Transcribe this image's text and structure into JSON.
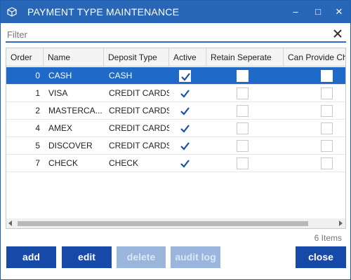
{
  "window": {
    "title": "PAYMENT TYPE MAINTENANCE",
    "minimize_glyph": "–",
    "maximize_glyph": "□",
    "close_glyph": "✕",
    "accent_color": "#2866b8"
  },
  "filter": {
    "placeholder": "Filter",
    "value": ""
  },
  "grid": {
    "columns": [
      "Order",
      "Name",
      "Deposit Type",
      "Active",
      "Retain Seperate",
      "Can Provide Cha"
    ],
    "selected_row": 0,
    "rows": [
      {
        "order": "0",
        "name": "CASH",
        "deposit_type": "CASH",
        "active": true,
        "retain_separate": false,
        "can_provide": false
      },
      {
        "order": "1",
        "name": "VISA",
        "deposit_type": "CREDIT CARDS",
        "active": true,
        "retain_separate": false,
        "can_provide": false
      },
      {
        "order": "2",
        "name": "MASTERCA...",
        "deposit_type": "CREDIT CARDS",
        "active": true,
        "retain_separate": false,
        "can_provide": false
      },
      {
        "order": "4",
        "name": "AMEX",
        "deposit_type": "CREDIT CARDS",
        "active": true,
        "retain_separate": false,
        "can_provide": false
      },
      {
        "order": "5",
        "name": "DISCOVER",
        "deposit_type": "CREDIT CARDS",
        "active": true,
        "retain_separate": false,
        "can_provide": false
      },
      {
        "order": "7",
        "name": "CHECK",
        "deposit_type": "CHECK",
        "active": true,
        "retain_separate": false,
        "can_provide": false
      }
    ]
  },
  "status": {
    "items_count": "6 Items"
  },
  "buttons": {
    "add": "add",
    "edit": "edit",
    "delete": "delete",
    "audit_log": "audit log",
    "close": "close"
  },
  "icons": {
    "app": "cube-icon",
    "filter_clear": "close-icon",
    "checkbox_check": "checkmark-icon"
  },
  "colors": {
    "selected_row": "#1f69c9",
    "button": "#1649a8",
    "button_disabled": "#9bb6dd",
    "checkmark": "#1a4fa6"
  }
}
